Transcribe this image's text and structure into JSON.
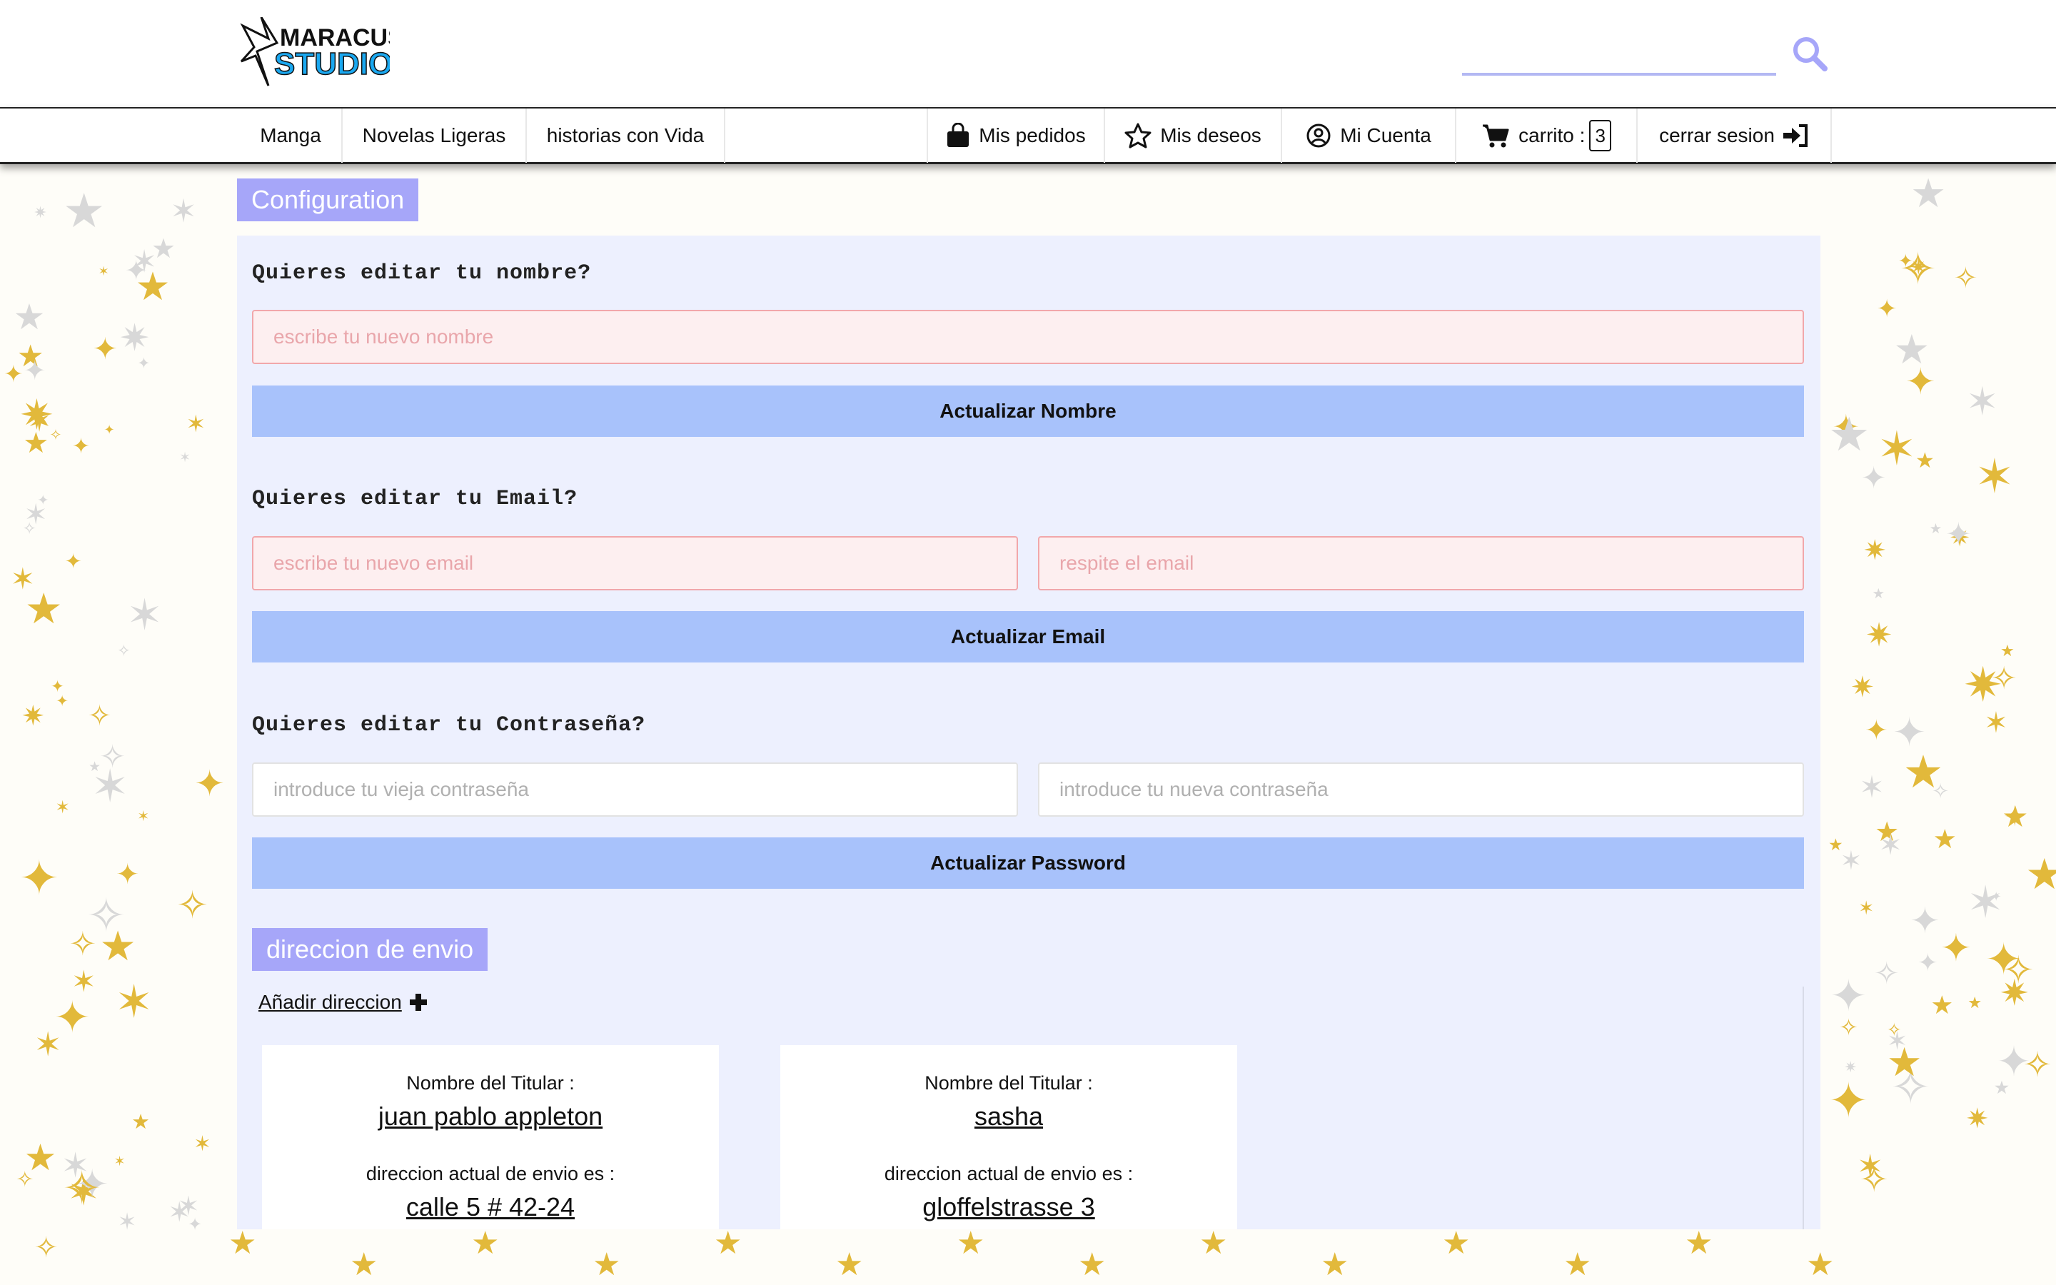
{
  "header": {
    "logo_line1": "MARACUS",
    "logo_line2": "STUDIO",
    "search_placeholder": ""
  },
  "nav": {
    "left": [
      "Manga",
      "Novelas Ligeras",
      "historias con Vida"
    ],
    "orders": "Mis pedidos",
    "wishes": "Mis deseos",
    "account": "Mi Cuenta",
    "cart_label": "carrito :",
    "cart_count": "3",
    "logout": "cerrar sesion"
  },
  "config": {
    "title": "Configuration",
    "name_question": "Quieres editar tu nombre?",
    "name_placeholder": "escribe tu nuevo nombre",
    "name_button": "Actualizar Nombre",
    "email_question": "Quieres editar tu Email?",
    "email_placeholder": "escribe tu nuevo email",
    "email_repeat_placeholder": "respite el email",
    "email_button": "Actualizar Email",
    "password_question": "Quieres editar tu Contraseña?",
    "old_password_placeholder": "introduce tu vieja contraseña",
    "new_password_placeholder": "introduce tu nueva contraseña",
    "password_button": "Actualizar Password"
  },
  "shipping": {
    "title": "direccion de envio",
    "add_label": "Añadir direccion",
    "holder_label": "Nombre del Titular :",
    "address_label": "direccion actual de envio es :",
    "cards": [
      {
        "holder": "juan pablo appleton",
        "address": "calle 5 # 42-24"
      },
      {
        "holder": "sasha",
        "address": "gloffelstrasse 3"
      }
    ]
  },
  "colors": {
    "accent": "#a6a6f9",
    "button": "#a8c2fb",
    "panel": "#edf0fe",
    "error_field": "#fdeff0",
    "star": "#e2b93b"
  }
}
